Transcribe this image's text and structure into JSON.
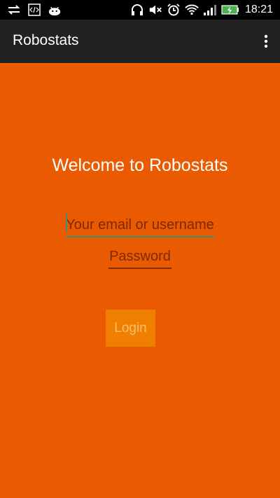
{
  "status_bar": {
    "time": "18:21",
    "icons": [
      "data-transfer-icon",
      "code-icon",
      "android-icon",
      "headphones-icon",
      "mute-icon",
      "alarm-icon",
      "wifi-icon",
      "signal-icon",
      "battery-charging-icon"
    ]
  },
  "app_bar": {
    "title": "Robostats",
    "menu_icon": "overflow-menu-icon"
  },
  "main": {
    "welcome": "Welcome to Robostats",
    "email_placeholder": "Your email or username",
    "password_placeholder": "Password",
    "login_label": "Login"
  },
  "colors": {
    "background": "#ea5a00",
    "app_bar": "#222222",
    "accent": "#3a8f7e",
    "button": "#f07f00"
  }
}
